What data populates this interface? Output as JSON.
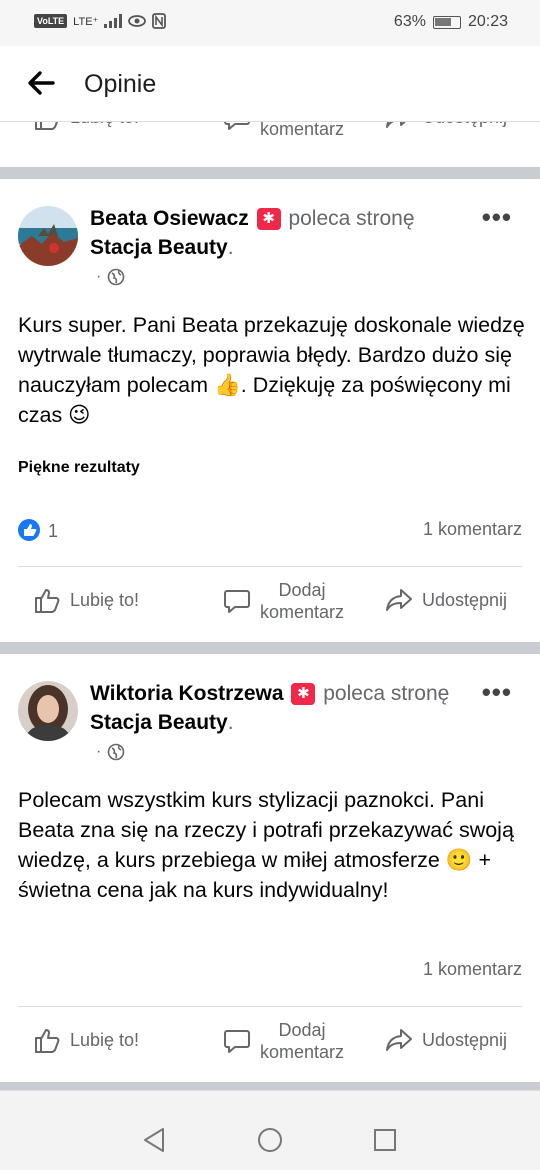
{
  "status": {
    "left_badge": "VoLTE",
    "lte": "LTE⁺",
    "battery": "63%",
    "time": "20:23"
  },
  "header": {
    "title": "Opinie"
  },
  "actions": {
    "like": "Lubię to!",
    "comment_1": "Dodaj",
    "comment_2": "komentarz",
    "share": "Udostępnij"
  },
  "posts": [
    {
      "author": "Beata Osiewacz",
      "recommends": "poleca stronę",
      "page": "Stacja Beauty",
      "text": "Kurs super. Pani Beata przekazuję doskonale wiedzę wytrwale tłumaczy, poprawia błędy. Bardzo dużo się nauczyłam polecam 👍. Dziękuję za poświęcony mi czas 😉",
      "tag": "Piękne rezultaty",
      "likes": "1",
      "comments": "1 komentarz"
    },
    {
      "author": "Wiktoria Kostrzewa",
      "recommends": "poleca stronę",
      "page": "Stacja Beauty",
      "text": "Polecam wszystkim kurs stylizacji paznokci. Pani Beata zna się na rzeczy i potrafi przekazywać swoją wiedzę, a kurs przebiega w miłej atmosferze 🙂 + świetna cena jak na kurs indywidualny!",
      "comments": "1 komentarz"
    }
  ],
  "colors": {
    "accent": "#1877f2",
    "recommend_badge": "#f02849",
    "separator": "#c9ccd1",
    "secondary_text": "#65676b"
  }
}
